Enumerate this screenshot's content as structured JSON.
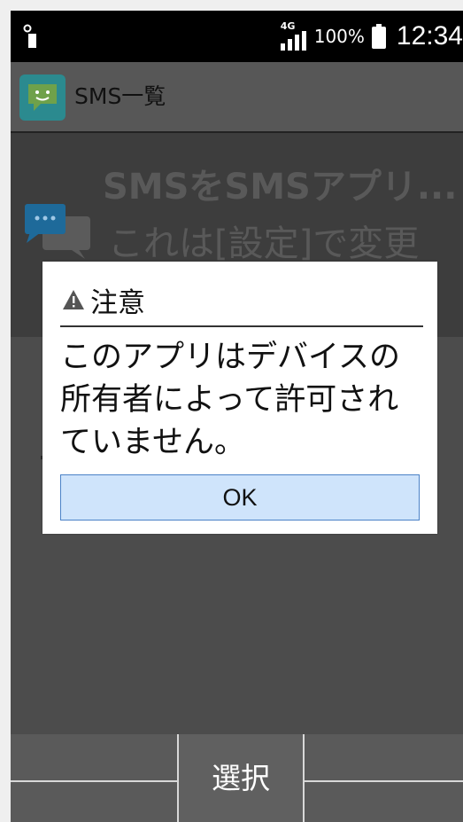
{
  "status_bar": {
    "network_type": "4G",
    "battery_percent": "100%",
    "time": "12:34",
    "icons": [
      "notification-icon",
      "signal-icon",
      "battery-icon"
    ]
  },
  "app_bar": {
    "title": "SMS一覧",
    "icon": "sms-app-icon"
  },
  "background_content": {
    "line1": "SMSをSMSアプリ...",
    "line2": "これは[設定]で変更",
    "icon": "chat-bubbles-icon"
  },
  "dialog": {
    "title": "注意",
    "title_icon": "warning-icon",
    "message": "このアプリはデバイスの所有者によって許可されていません。",
    "ok_label": "OK"
  },
  "soft_keys": {
    "center_label": "選択"
  },
  "colors": {
    "dialog_button_bg": "#cfe4fb",
    "dialog_button_border": "#4b82c7",
    "app_icon_teal": "#2b8a8f"
  }
}
